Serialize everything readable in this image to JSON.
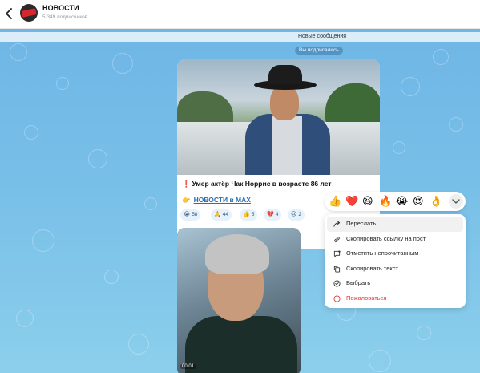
{
  "header": {
    "title": "НОВОСТИ",
    "subscribers": "5 349 подписчиков"
  },
  "chat": {
    "new_messages": "Новые сообщения",
    "subscribed": "Вы подписались"
  },
  "post1": {
    "caption_emoji": "❗",
    "caption": "Умер актёр Чак Норрис в возрасте 86 лет",
    "link_emoji": "👉",
    "link_text": "НОВОСТИ в MAX",
    "reactions": [
      {
        "emoji": "😭",
        "count": "58"
      },
      {
        "emoji": "🙏",
        "count": "44"
      },
      {
        "emoji": "👍",
        "count": "5"
      },
      {
        "emoji": "💔",
        "count": "4"
      },
      {
        "emoji": "😢",
        "count": "2"
      }
    ]
  },
  "post2": {
    "timecode": "00:01"
  },
  "emoji_bar": [
    "👍",
    "❤️",
    "😆",
    "🔥",
    "😭",
    "😍",
    "👌"
  ],
  "menu": {
    "items": [
      {
        "label": "Переслать",
        "icon": "forward-icon"
      },
      {
        "label": "Скопировать ссылку на пост",
        "icon": "link-icon"
      },
      {
        "label": "Отметить непрочитанным",
        "icon": "unread-icon"
      },
      {
        "label": "Скопировать текст",
        "icon": "copy-icon"
      },
      {
        "label": "Выбрать",
        "icon": "select-icon"
      },
      {
        "label": "Пожаловаться",
        "icon": "report-icon"
      }
    ],
    "danger_color": "#e03a3a"
  }
}
